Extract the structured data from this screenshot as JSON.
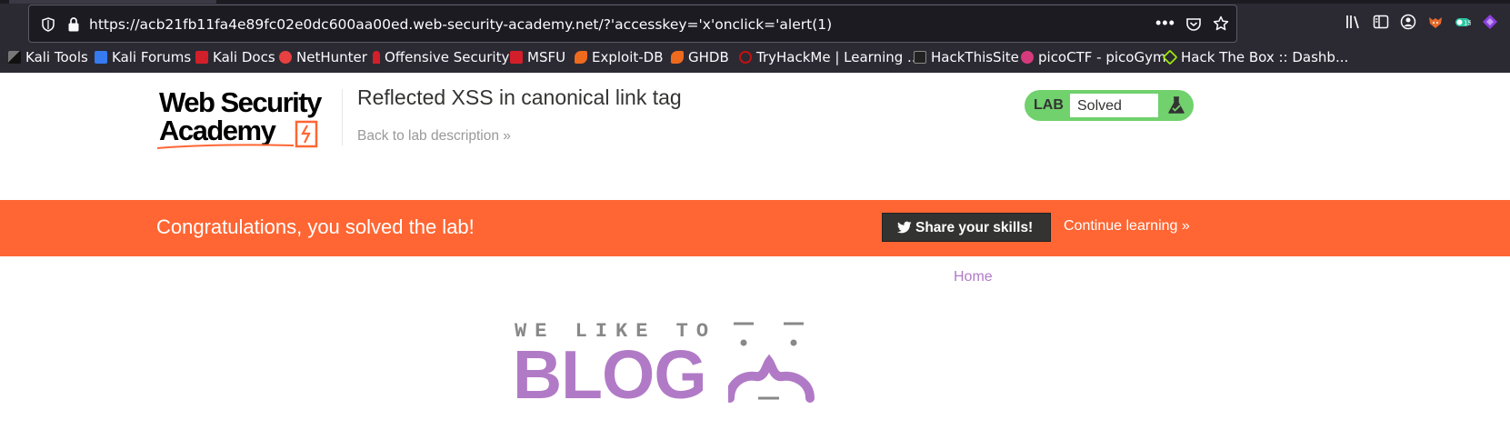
{
  "browser": {
    "url": "https://acb21fb11fa4e89fc02e0dc600aa00ed.web-security-academy.net/?'accesskey='x'onclick='alert(1)",
    "bookmarks": [
      {
        "label": "Kali Tools",
        "icon": "kali-dragon-icon",
        "color": "#1a1a1a"
      },
      {
        "label": "Kali Forums",
        "icon": "kali-forums-icon",
        "color": "#367bf0"
      },
      {
        "label": "Kali Docs",
        "icon": "kali-docs-icon",
        "color": "#d31f2a"
      },
      {
        "label": "NetHunter",
        "icon": "nethunter-icon",
        "color": "#e64040"
      },
      {
        "label": "Offensive Security",
        "icon": "offsec-icon",
        "color": "#d31f2a"
      },
      {
        "label": "MSFU",
        "icon": "msfu-icon",
        "color": "#d31f2a"
      },
      {
        "label": "Exploit-DB",
        "icon": "exploit-db-icon",
        "color": "#ee6a1e"
      },
      {
        "label": "GHDB",
        "icon": "ghdb-icon",
        "color": "#ee6a1e"
      },
      {
        "label": "TryHackMe | Learning ...",
        "icon": "tryhackme-icon",
        "color": "#c11111"
      },
      {
        "label": "HackThisSite",
        "icon": "hackthissite-icon",
        "color": "#222222"
      },
      {
        "label": "picoCTF - picoGym",
        "icon": "picoctf-icon",
        "color": "#d63a7c"
      },
      {
        "label": "Hack The Box :: Dashb...",
        "icon": "hackthebox-icon",
        "color": "#9fef00"
      }
    ]
  },
  "header": {
    "logo_line1": "Web Security",
    "logo_line2": "Academy",
    "lab_title": "Reflected XSS in canonical link tag",
    "back_link": "Back to lab description »",
    "status_badge": "LAB",
    "status_value": "Solved"
  },
  "banner": {
    "message": "Congratulations, you solved the lab!",
    "share_label": "Share your skills!",
    "continue_label": "Continue learning »"
  },
  "nav": {
    "home": "Home"
  },
  "blog": {
    "tagline": "WE LIKE TO",
    "title": "BLOG"
  },
  "colors": {
    "accent_orange": "#ff6633",
    "solved_green": "#70d16d",
    "blog_purple": "#b17ac6",
    "chrome_bg": "#2b2a33"
  }
}
